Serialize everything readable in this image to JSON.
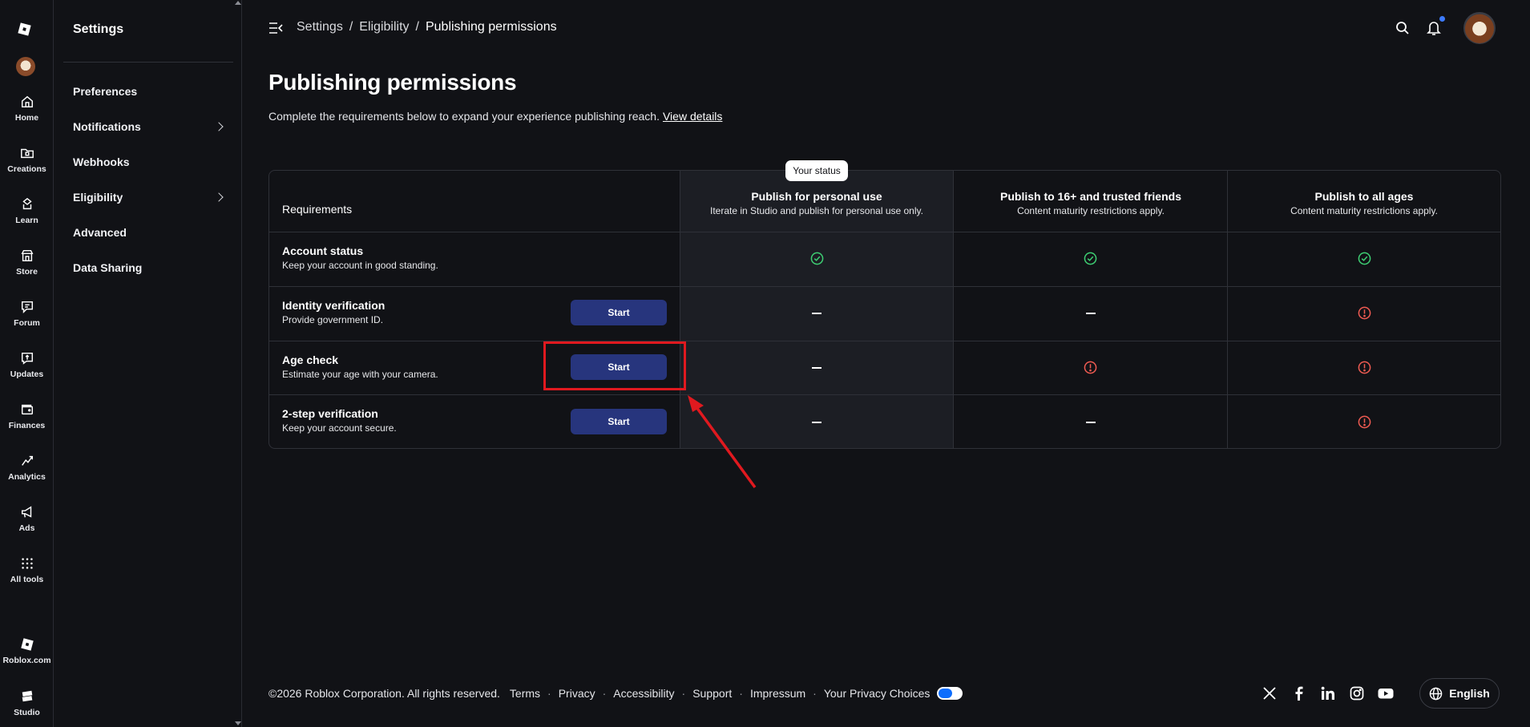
{
  "rail": {
    "items": [
      {
        "label": "Home",
        "icon": "home-icon"
      },
      {
        "label": "Creations",
        "icon": "creations-icon"
      },
      {
        "label": "Learn",
        "icon": "learn-icon"
      },
      {
        "label": "Store",
        "icon": "store-icon"
      },
      {
        "label": "Forum",
        "icon": "forum-icon"
      },
      {
        "label": "Updates",
        "icon": "updates-icon"
      },
      {
        "label": "Finances",
        "icon": "finances-icon"
      },
      {
        "label": "Analytics",
        "icon": "analytics-icon"
      },
      {
        "label": "Ads",
        "icon": "ads-icon"
      },
      {
        "label": "All tools",
        "icon": "grid-icon"
      }
    ],
    "bottom": [
      {
        "label": "Roblox.com",
        "icon": "roblox-logo-icon"
      },
      {
        "label": "Studio",
        "icon": "studio-icon"
      }
    ]
  },
  "sidebar": {
    "title": "Settings",
    "items": [
      {
        "label": "Preferences"
      },
      {
        "label": "Notifications"
      },
      {
        "label": "Webhooks"
      },
      {
        "label": "Eligibility"
      },
      {
        "label": "Advanced"
      },
      {
        "label": "Data Sharing"
      }
    ]
  },
  "header": {
    "breadcrumb": [
      "Settings",
      "Eligibility",
      "Publishing permissions"
    ],
    "separator": "/",
    "notification_dot_color": "#3d7bff"
  },
  "page": {
    "title": "Publishing permissions",
    "description": "Complete the requirements below to expand your experience publishing reach.",
    "details_link": "View details"
  },
  "table": {
    "status_tag": "Your status",
    "requirements_header": "Requirements",
    "columns": [
      {
        "title": "Publish for personal use",
        "subtitle": "Iterate in Studio and publish for personal use only."
      },
      {
        "title": "Publish to 16+ and trusted friends",
        "subtitle": "Content maturity restrictions apply."
      },
      {
        "title": "Publish to all ages",
        "subtitle": "Content maturity restrictions apply."
      }
    ],
    "rows": [
      {
        "title": "Account status",
        "subtitle": "Keep your account in good standing.",
        "button": "",
        "statuses": [
          "check",
          "check",
          "check"
        ]
      },
      {
        "title": "Identity verification",
        "subtitle": "Provide government ID.",
        "button": "Start",
        "statuses": [
          "dash",
          "dash",
          "alert"
        ]
      },
      {
        "title": "Age check",
        "subtitle": "Estimate your age with your camera.",
        "button": "Start",
        "statuses": [
          "dash",
          "alert",
          "alert"
        ]
      },
      {
        "title": "2-step verification",
        "subtitle": "Keep your account secure.",
        "button": "Start",
        "statuses": [
          "dash",
          "dash",
          "alert"
        ]
      }
    ],
    "colors": {
      "check": "#3ecf73",
      "alert": "#f05b52",
      "button": "#27357d",
      "highlight_annotation": "#e0191f"
    }
  },
  "footer": {
    "copyright": "©2026 Roblox Corporation. All rights reserved.",
    "links": [
      "Terms",
      "Privacy",
      "Accessibility",
      "Support",
      "Impressum",
      "Your Privacy Choices"
    ],
    "social": [
      "x-icon",
      "facebook-icon",
      "linkedin-icon",
      "instagram-icon",
      "youtube-icon"
    ],
    "language": "English"
  }
}
